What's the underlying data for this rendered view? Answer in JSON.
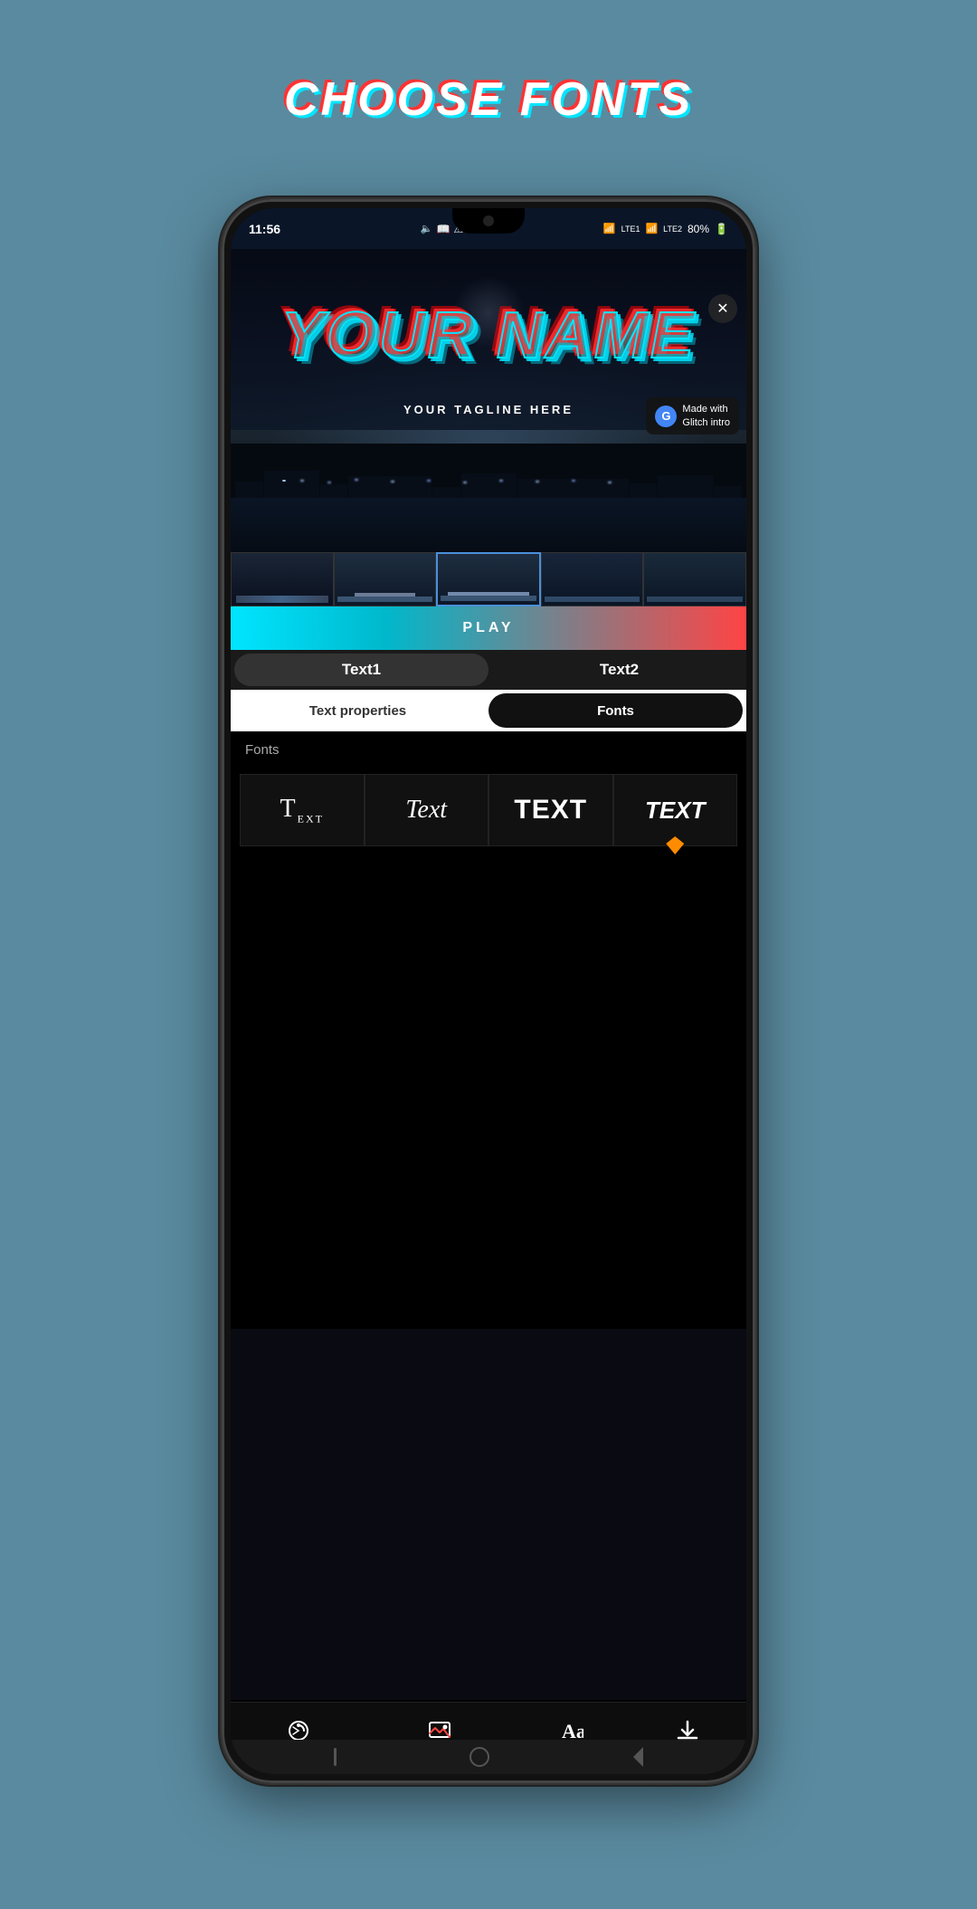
{
  "page": {
    "title": "CHOOSE FONTS",
    "background_color": "#5a8a9f"
  },
  "phone": {
    "status_bar": {
      "time": "11:56",
      "battery": "80%"
    },
    "preview": {
      "main_text": "YOUR NAME",
      "tagline": "YOUR TAGLINE HERE",
      "made_with_label": "Made with\nGlitch intro",
      "close_icon": "✕"
    },
    "play_button": {
      "label": "PLAY"
    },
    "text_tabs": [
      {
        "label": "Text1",
        "active": true
      },
      {
        "label": "Text2",
        "active": false
      }
    ],
    "prop_tabs": [
      {
        "label": "Text properties",
        "active": false
      },
      {
        "label": "Fonts",
        "active": true
      }
    ],
    "fonts_section": {
      "section_label": "Fonts",
      "font_items": [
        {
          "text": "TEXT",
          "style": "font1"
        },
        {
          "text": "Text",
          "style": "font2"
        },
        {
          "text": "TEXT",
          "style": "font3"
        },
        {
          "text": "TEXT",
          "style": "font4",
          "has_diamond": true
        }
      ]
    },
    "bottom_nav": {
      "items": [
        {
          "label": "Animation",
          "icon": "animation-icon"
        },
        {
          "label": "Background",
          "icon": "background-icon"
        },
        {
          "label": "Text",
          "icon": "text-icon"
        },
        {
          "label": "Save",
          "icon": "save-icon"
        }
      ]
    }
  }
}
